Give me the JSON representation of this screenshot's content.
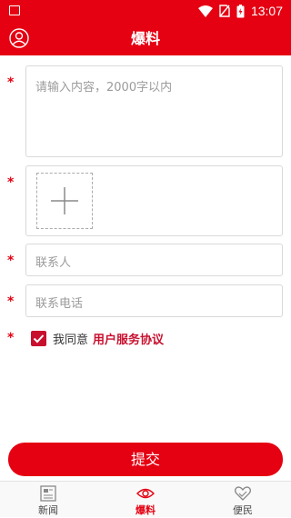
{
  "status_bar": {
    "time": "13:07"
  },
  "header": {
    "title": "爆料"
  },
  "form": {
    "required_mark": "*",
    "content_placeholder": "请输入内容，2000字以内",
    "contact_placeholder": "联系人",
    "phone_placeholder": "联系电话",
    "agree_text": "我同意",
    "agreement_link": "用户服务协议",
    "agreement_checked": true
  },
  "submit_label": "提交",
  "tabbar": {
    "tabs": [
      {
        "label": "新闻",
        "icon": "newspaper-icon",
        "active": false
      },
      {
        "label": "爆料",
        "icon": "eye-icon",
        "active": true
      },
      {
        "label": "便民",
        "icon": "heart-hands-icon",
        "active": false
      }
    ]
  },
  "colors": {
    "brand_red": "#e50012",
    "placeholder_gray": "#9b9b9b",
    "link_red": "#c8102e"
  }
}
